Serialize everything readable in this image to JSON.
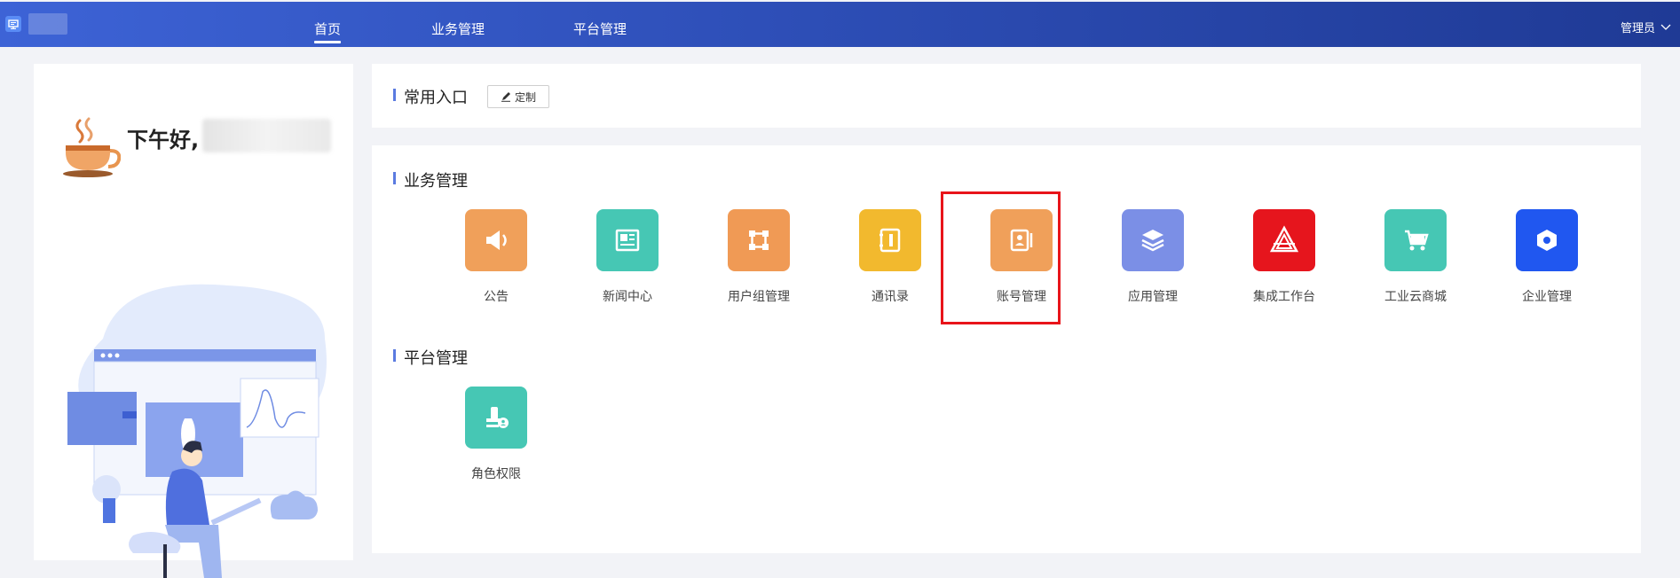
{
  "nav": {
    "items": [
      {
        "label": "首页",
        "active": true
      },
      {
        "label": "业务管理",
        "active": false
      },
      {
        "label": "平台管理",
        "active": false
      }
    ],
    "user_label": "管理员"
  },
  "greeting": {
    "text": "下午好,"
  },
  "common_entry": {
    "title": "常用入口",
    "custom_button": "定制"
  },
  "business": {
    "title": "业务管理",
    "apps": [
      {
        "label": "公告",
        "icon": "megaphone-icon",
        "color": "#f0a05a"
      },
      {
        "label": "新闻中心",
        "icon": "newspaper-icon",
        "color": "#46c7b4"
      },
      {
        "label": "用户组管理",
        "icon": "user-group-icon",
        "color": "#f09a55"
      },
      {
        "label": "通讯录",
        "icon": "address-book-icon",
        "color": "#f2b92e"
      },
      {
        "label": "账号管理",
        "icon": "account-card-icon",
        "color": "#f0a05a"
      },
      {
        "label": "应用管理",
        "icon": "layers-icon",
        "color": "#7b8fe6"
      },
      {
        "label": "集成工作台",
        "icon": "integration-logo-icon",
        "color": "#e6151d"
      },
      {
        "label": "工业云商城",
        "icon": "shopping-cart-icon",
        "color": "#46c7b4"
      },
      {
        "label": "企业管理",
        "icon": "hexagon-icon",
        "color": "#2057f0"
      }
    ]
  },
  "platform": {
    "title": "平台管理",
    "apps": [
      {
        "label": "角色权限",
        "icon": "role-permission-icon",
        "color": "#46c7b4"
      }
    ]
  },
  "colors": {
    "header_start": "#3d63d6",
    "header_end": "#1f3a95",
    "accent": "#5b7be0",
    "highlight": "#e8141a"
  }
}
